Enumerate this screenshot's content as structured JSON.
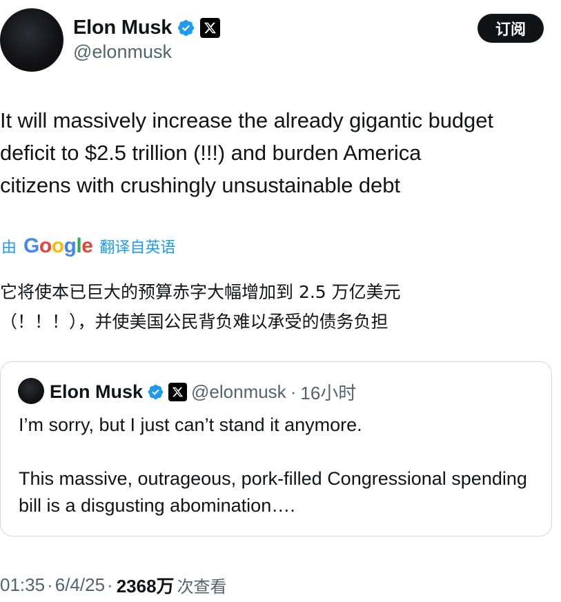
{
  "author": {
    "name": "Elon Musk",
    "handle": "@elonmusk",
    "verified_color": "#1d9bf0",
    "badges": [
      "verified-badge-icon",
      "x-logo-icon"
    ]
  },
  "subscribe_button": "订阅",
  "tweet": {
    "text": "It will massively increase the already gigantic budget\ndeficit to $2.5 trillion (!!!) and burden America\ncitizens with crushingly unsustainable debt"
  },
  "translation": {
    "prefix": "由",
    "provider": "Google",
    "label": "翻译自英语",
    "text": "它将使本已巨大的预算赤字大幅增加到 2.5 万亿美元\n（！！！），并使美国公民背负难以承受的债务负担"
  },
  "quoted_tweet": {
    "name": "Elon Musk",
    "handle": "@elonmusk",
    "separator": "·",
    "time": "16小时",
    "paragraphs": [
      "I’m sorry, but I just can’t stand it anymore.",
      "This massive, outrageous, pork-filled Congressional spending bill is a disgusting abomination…."
    ]
  },
  "footer": {
    "time": "01:35",
    "date": "6/4/25",
    "separator": "·",
    "views_count": "2368万",
    "views_label": "次查看"
  }
}
